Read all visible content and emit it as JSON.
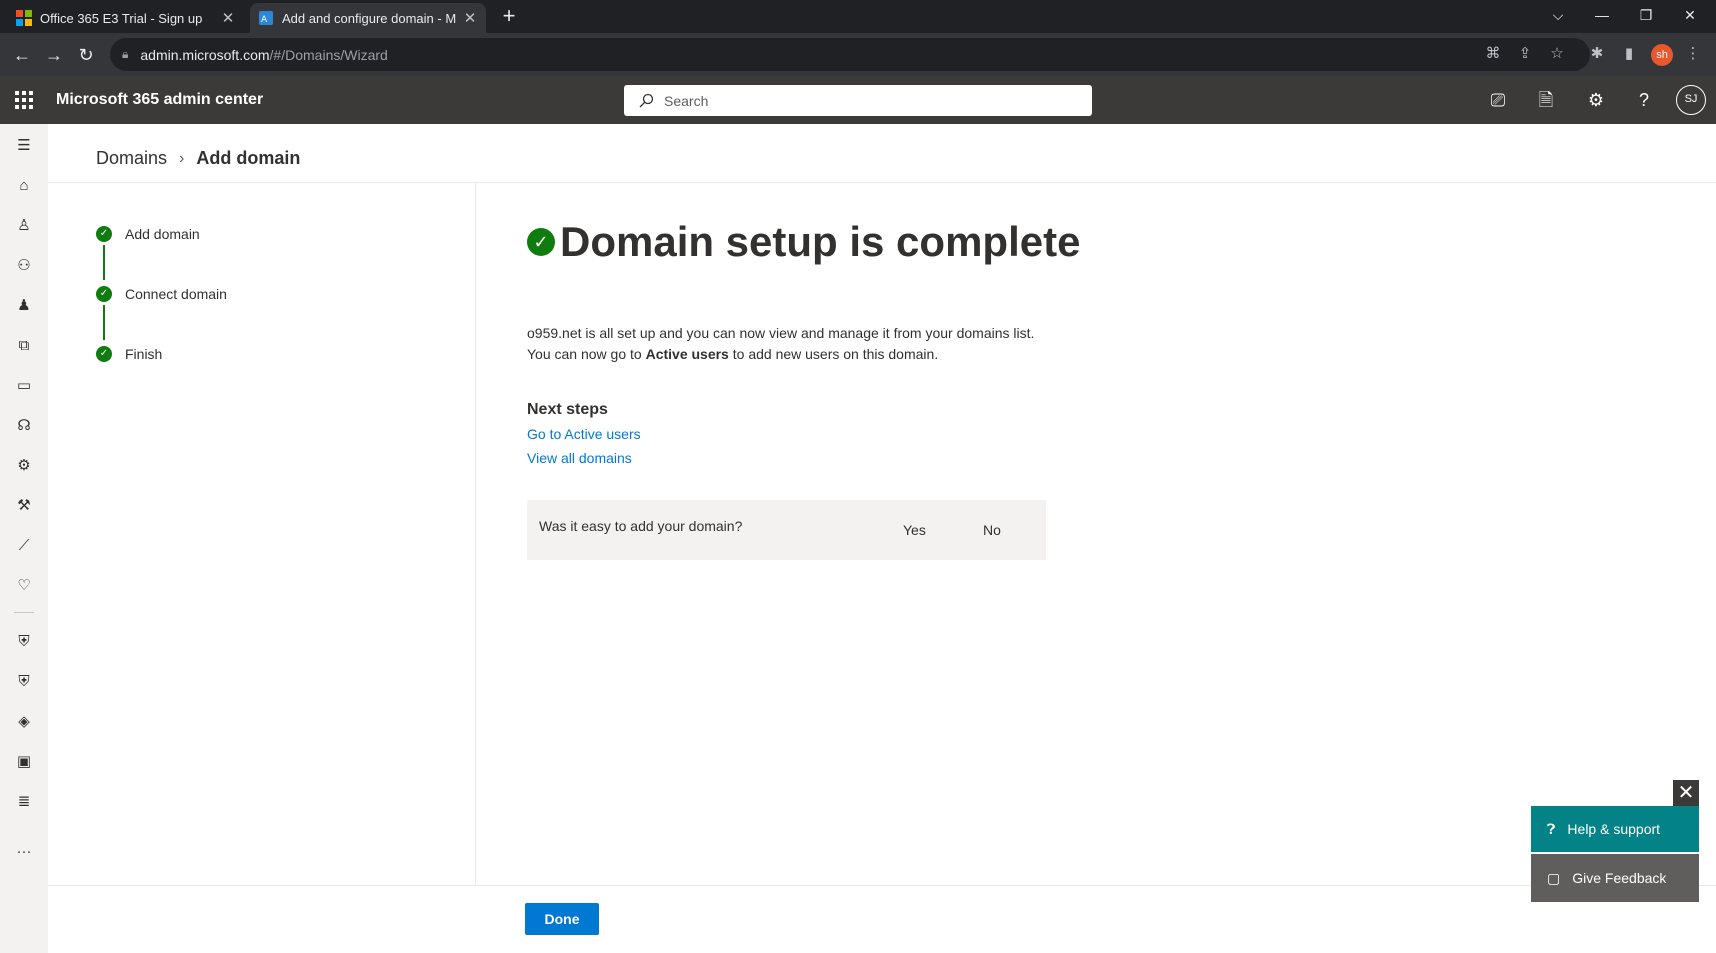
{
  "browser": {
    "tabs": [
      {
        "title": "Office 365 E3 Trial - Sign up",
        "active": false
      },
      {
        "title": "Add and configure domain - M",
        "active": true
      }
    ],
    "url_host": "admin.microsoft.com",
    "url_path": "/#/Domains/Wizard",
    "profile_initials": "sh"
  },
  "header": {
    "app_name": "Microsoft 365 admin center",
    "search_placeholder": "Search",
    "avatar_initials": "SJ"
  },
  "breadcrumb": {
    "parent": "Domains",
    "current": "Add domain"
  },
  "steps": [
    "Add domain",
    "Connect domain",
    "Finish"
  ],
  "main": {
    "title": "Domain setup is complete",
    "desc_line1": "o959.net is all set up and you can now view and manage it from your domains list.",
    "desc_line2_pre": "You can now go to ",
    "desc_line2_bold": "Active users",
    "desc_line2_post": " to add new users on this domain.",
    "next_steps_heading": "Next steps",
    "links": [
      "Go to Active users",
      "View all domains"
    ],
    "feedback_question": "Was it easy to add your domain?",
    "feedback_yes": "Yes",
    "feedback_no": "No"
  },
  "footer": {
    "done_label": "Done"
  },
  "help": {
    "help_label": "Help & support",
    "feedback_label": "Give Feedback"
  },
  "colors": {
    "success_green": "#107c10",
    "primary_blue": "#0078d4",
    "help_teal": "#038387",
    "suite_bar": "#3b3a39"
  }
}
